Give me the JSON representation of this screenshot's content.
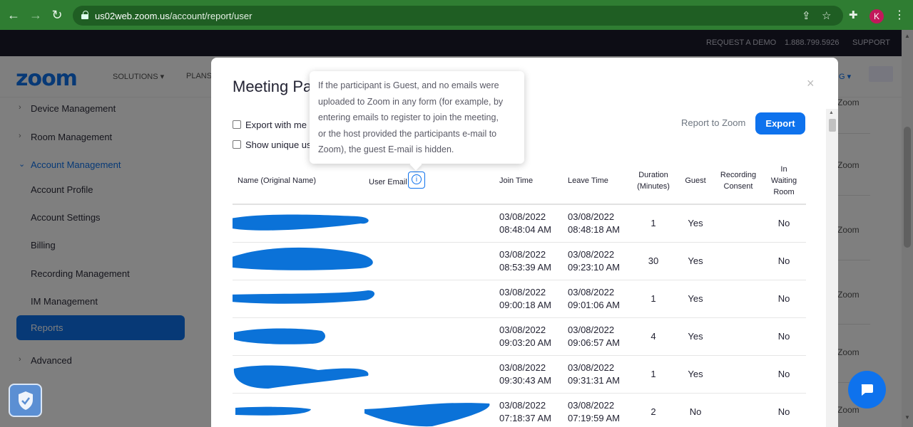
{
  "browser": {
    "url_host": "us02web.zoom.us",
    "url_path": "/account/report/user",
    "avatar_letter": "K"
  },
  "topstrip": {
    "request_demo": "REQUEST A DEMO",
    "phone": "1.888.799.5926",
    "support": "SUPPORT"
  },
  "nav": {
    "logo": "zoom",
    "solutions": "SOLUTIONS ▾",
    "plans": "PLANS",
    "right_fragment": "G ▾"
  },
  "sidebar": {
    "items": [
      {
        "label": "Device Management",
        "chev": "›"
      },
      {
        "label": "Room Management",
        "chev": "›"
      },
      {
        "label": "Account Management",
        "chev": "⌄"
      },
      {
        "label": "Account Profile"
      },
      {
        "label": "Account Settings"
      },
      {
        "label": "Billing"
      },
      {
        "label": "Recording Management"
      },
      {
        "label": "IM Management"
      },
      {
        "label": "Reports"
      },
      {
        "label": "Advanced",
        "chev": "›"
      }
    ]
  },
  "background_right": [
    "Zoom",
    "Zoom",
    "Zoom",
    "Zoom",
    "Zoom",
    "Zoom"
  ],
  "modal": {
    "title": "Meeting Pa",
    "close": "×",
    "export_with_meeting": "Export with me",
    "show_unique": "Show unique us",
    "report_to_zoom": "Report to Zoom",
    "export": "Export"
  },
  "tooltip": {
    "lines": [
      "If the participant is Guest, and no emails were",
      "uploaded to Zoom in any form (for example, by",
      "entering emails to register to join the meeting,",
      "or the host provided the participants e-mail to",
      "Zoom), the guest E-mail is hidden."
    ]
  },
  "table": {
    "headers": {
      "name": "Name (Original Name)",
      "email": "User Email",
      "join": "Join Time",
      "leave": "Leave Time",
      "duration_1": "Duration",
      "duration_2": "(Minutes)",
      "guest": "Guest",
      "recording_1": "Recording",
      "recording_2": "Consent",
      "waiting_1": "In",
      "waiting_2": "Waiting",
      "waiting_3": "Room"
    },
    "rows": [
      {
        "join_date": "03/08/2022",
        "join_time": "08:48:04 AM",
        "leave_date": "03/08/2022",
        "leave_time": "08:48:18 AM",
        "duration": "1",
        "guest": "Yes",
        "waiting": "No"
      },
      {
        "join_date": "03/08/2022",
        "join_time": "08:53:39 AM",
        "leave_date": "03/08/2022",
        "leave_time": "09:23:10 AM",
        "duration": "30",
        "guest": "Yes",
        "waiting": "No"
      },
      {
        "join_date": "03/08/2022",
        "join_time": "09:00:18 AM",
        "leave_date": "03/08/2022",
        "leave_time": "09:01:06 AM",
        "duration": "1",
        "guest": "Yes",
        "waiting": "No"
      },
      {
        "join_date": "03/08/2022",
        "join_time": "09:03:20 AM",
        "leave_date": "03/08/2022",
        "leave_time": "09:06:57 AM",
        "duration": "4",
        "guest": "Yes",
        "waiting": "No"
      },
      {
        "join_date": "03/08/2022",
        "join_time": "09:30:43 AM",
        "leave_date": "03/08/2022",
        "leave_time": "09:31:31 AM",
        "duration": "1",
        "guest": "Yes",
        "waiting": "No"
      },
      {
        "join_date": "03/08/2022",
        "join_time": "07:18:37 AM",
        "leave_date": "03/08/2022",
        "leave_time": "07:19:59 AM",
        "duration": "2",
        "guest": "No",
        "waiting": "No"
      }
    ]
  },
  "colors": {
    "accent": "#0e72ed",
    "browser_frame": "#2f7d32",
    "redaction": "#0b72d8"
  }
}
